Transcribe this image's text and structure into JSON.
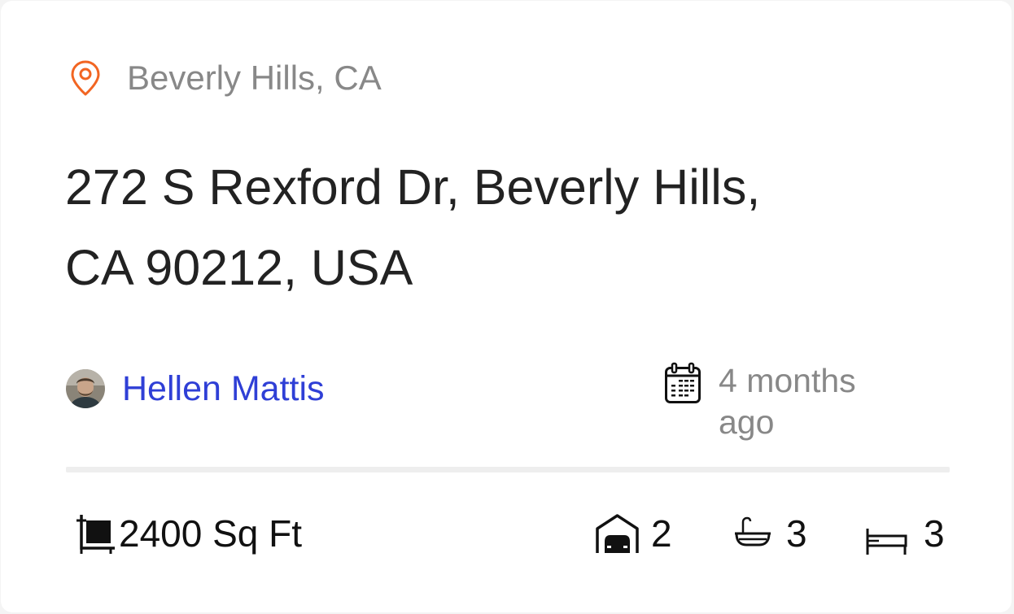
{
  "location": {
    "icon": "map-pin-icon",
    "text": "Beverly Hills, CA",
    "icon_color": "#f26522"
  },
  "address": "272 S Rexford Dr, Beverly Hills, CA 90212, USA",
  "agent": {
    "name": "Hellen Mattis",
    "name_color": "#2f3fd6"
  },
  "posted": {
    "icon": "calendar-icon",
    "text": "4 months ago"
  },
  "stats": {
    "area": {
      "icon": "floor-area-icon",
      "value": "2400 Sq Ft"
    },
    "garages": {
      "icon": "garage-icon",
      "value": "2"
    },
    "bathrooms": {
      "icon": "bathtub-icon",
      "value": "3"
    },
    "bedrooms": {
      "icon": "bed-icon",
      "value": "3"
    }
  }
}
